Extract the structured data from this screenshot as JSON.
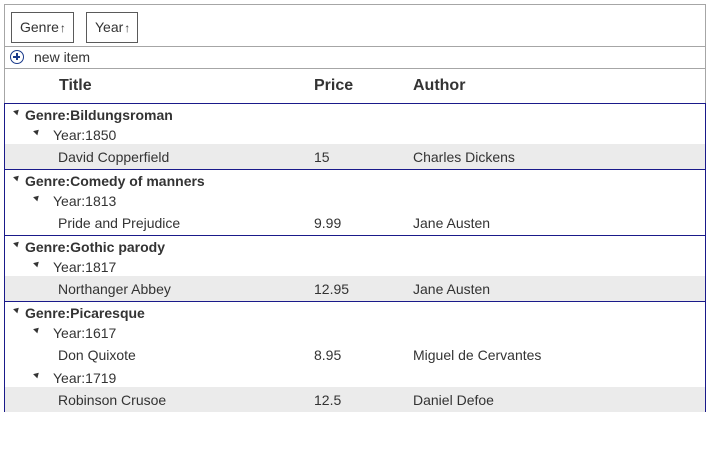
{
  "grouping": {
    "chips": [
      {
        "label": "Genre",
        "arrow": "↑"
      },
      {
        "label": "Year",
        "arrow": "↑"
      }
    ]
  },
  "toolbar": {
    "new_item_label": "new item"
  },
  "columns": [
    "Title",
    "Price",
    "Author"
  ],
  "groups": [
    {
      "genre_label": "Genre:Bildungsroman",
      "years": [
        {
          "year_label": "Year:1850",
          "rows": [
            {
              "title": "David Copperfield",
              "price": "15",
              "author": "Charles Dickens"
            }
          ]
        }
      ]
    },
    {
      "genre_label": "Genre:Comedy of manners",
      "years": [
        {
          "year_label": "Year:1813",
          "rows": [
            {
              "title": "Pride and Prejudice",
              "price": "9.99",
              "author": "Jane Austen"
            }
          ]
        }
      ]
    },
    {
      "genre_label": "Genre:Gothic parody",
      "years": [
        {
          "year_label": "Year:1817",
          "rows": [
            {
              "title": "Northanger Abbey",
              "price": "12.95",
              "author": "Jane Austen"
            }
          ]
        }
      ]
    },
    {
      "genre_label": "Genre:Picaresque",
      "years": [
        {
          "year_label": "Year:1617",
          "rows": [
            {
              "title": "Don Quixote",
              "price": "8.95",
              "author": "Miguel de Cervantes"
            }
          ]
        },
        {
          "year_label": "Year:1719",
          "rows": [
            {
              "title": "Robinson Crusoe",
              "price": "12.5",
              "author": "Daniel Defoe"
            }
          ]
        }
      ]
    }
  ]
}
